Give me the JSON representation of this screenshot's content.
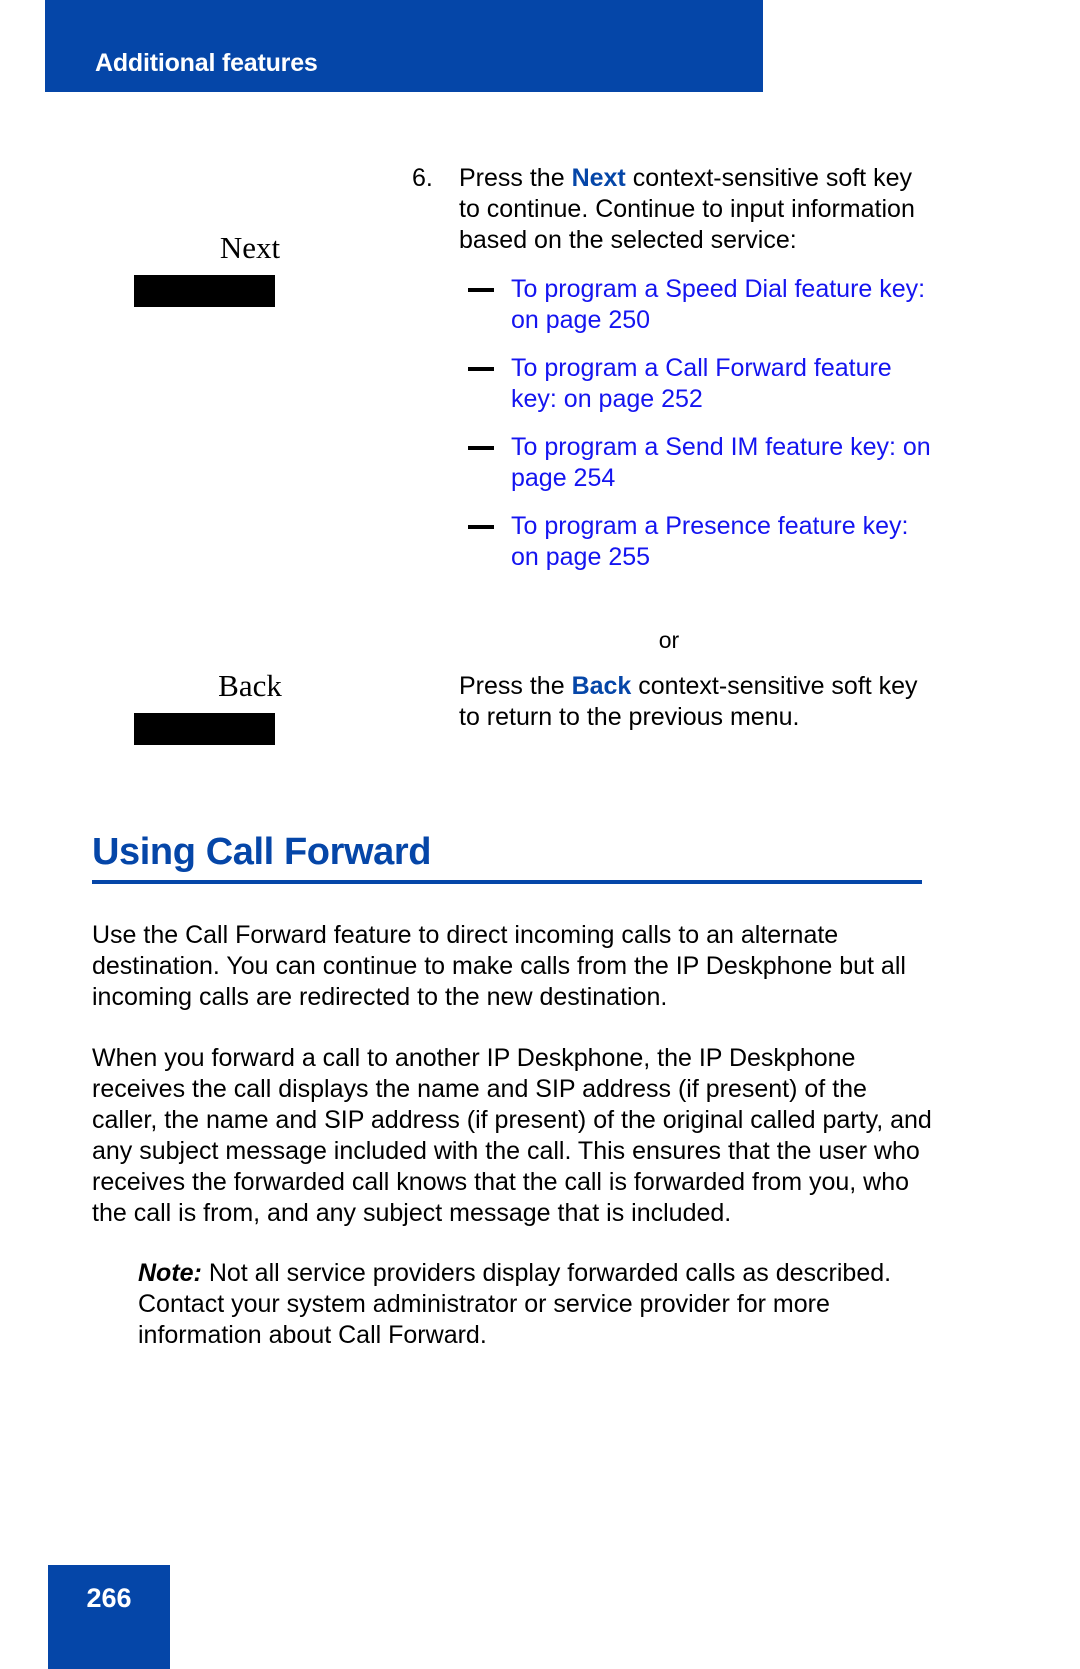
{
  "header": {
    "running_title": "Additional features"
  },
  "procedure": {
    "step": {
      "number": "6.",
      "text_before_keyword": "Press the ",
      "keyword": "Next",
      "text_after_keyword": " context-sensitive soft key to continue. Continue to input information based on the selected service:",
      "softkey_label": "Next"
    },
    "cross_references": [
      {
        "text": "To program a Speed Dial feature key:  on page 250"
      },
      {
        "text": "To program a Call Forward feature key:  on page 252"
      },
      {
        "text": "To program a Send IM feature key: on page 254"
      },
      {
        "text": "To program a Presence feature key:  on page 255"
      }
    ],
    "or_label": "or",
    "alt_step": {
      "text_before_keyword": "Press the ",
      "keyword": "Back",
      "text_after_keyword": " context-sensitive soft key to return to the previous menu.",
      "softkey_label": "Back"
    }
  },
  "section": {
    "title": "Using Call Forward",
    "paragraphs": [
      "Use the Call Forward feature to direct incoming calls to an alternate destination. You can continue to make calls from the IP Deskphone but all incoming calls are redirected to the new destination.",
      "When you forward a call to another IP Deskphone, the IP Deskphone receives the call displays the name and SIP address (if present) of the caller, the name and SIP address (if present) of the original called party, and any subject message included with the call. This ensures that the user who receives the forwarded call knows that the call is forwarded from you, who the call is from, and any subject message that is included."
    ],
    "note": {
      "label": "Note:",
      "text": " Not all service providers display forwarded calls as described. Contact your system administrator or service provider for more information about Call Forward."
    }
  },
  "footer": {
    "page_number": "266"
  },
  "colors": {
    "brand_blue": "#0546a8",
    "link_blue": "#1414f0",
    "black": "#000000",
    "white": "#ffffff"
  }
}
